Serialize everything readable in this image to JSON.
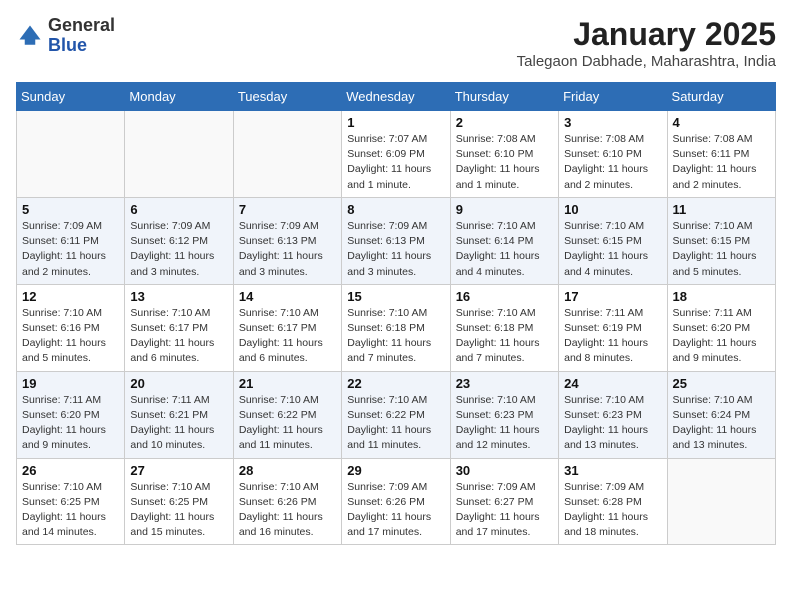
{
  "header": {
    "logo_general": "General",
    "logo_blue": "Blue",
    "month_year": "January 2025",
    "location": "Talegaon Dabhade, Maharashtra, India"
  },
  "days_of_week": [
    "Sunday",
    "Monday",
    "Tuesday",
    "Wednesday",
    "Thursday",
    "Friday",
    "Saturday"
  ],
  "weeks": [
    [
      {
        "day": "",
        "info": ""
      },
      {
        "day": "",
        "info": ""
      },
      {
        "day": "",
        "info": ""
      },
      {
        "day": "1",
        "info": "Sunrise: 7:07 AM\nSunset: 6:09 PM\nDaylight: 11 hours\nand 1 minute."
      },
      {
        "day": "2",
        "info": "Sunrise: 7:08 AM\nSunset: 6:10 PM\nDaylight: 11 hours\nand 1 minute."
      },
      {
        "day": "3",
        "info": "Sunrise: 7:08 AM\nSunset: 6:10 PM\nDaylight: 11 hours\nand 2 minutes."
      },
      {
        "day": "4",
        "info": "Sunrise: 7:08 AM\nSunset: 6:11 PM\nDaylight: 11 hours\nand 2 minutes."
      }
    ],
    [
      {
        "day": "5",
        "info": "Sunrise: 7:09 AM\nSunset: 6:11 PM\nDaylight: 11 hours\nand 2 minutes."
      },
      {
        "day": "6",
        "info": "Sunrise: 7:09 AM\nSunset: 6:12 PM\nDaylight: 11 hours\nand 3 minutes."
      },
      {
        "day": "7",
        "info": "Sunrise: 7:09 AM\nSunset: 6:13 PM\nDaylight: 11 hours\nand 3 minutes."
      },
      {
        "day": "8",
        "info": "Sunrise: 7:09 AM\nSunset: 6:13 PM\nDaylight: 11 hours\nand 3 minutes."
      },
      {
        "day": "9",
        "info": "Sunrise: 7:10 AM\nSunset: 6:14 PM\nDaylight: 11 hours\nand 4 minutes."
      },
      {
        "day": "10",
        "info": "Sunrise: 7:10 AM\nSunset: 6:15 PM\nDaylight: 11 hours\nand 4 minutes."
      },
      {
        "day": "11",
        "info": "Sunrise: 7:10 AM\nSunset: 6:15 PM\nDaylight: 11 hours\nand 5 minutes."
      }
    ],
    [
      {
        "day": "12",
        "info": "Sunrise: 7:10 AM\nSunset: 6:16 PM\nDaylight: 11 hours\nand 5 minutes."
      },
      {
        "day": "13",
        "info": "Sunrise: 7:10 AM\nSunset: 6:17 PM\nDaylight: 11 hours\nand 6 minutes."
      },
      {
        "day": "14",
        "info": "Sunrise: 7:10 AM\nSunset: 6:17 PM\nDaylight: 11 hours\nand 6 minutes."
      },
      {
        "day": "15",
        "info": "Sunrise: 7:10 AM\nSunset: 6:18 PM\nDaylight: 11 hours\nand 7 minutes."
      },
      {
        "day": "16",
        "info": "Sunrise: 7:10 AM\nSunset: 6:18 PM\nDaylight: 11 hours\nand 7 minutes."
      },
      {
        "day": "17",
        "info": "Sunrise: 7:11 AM\nSunset: 6:19 PM\nDaylight: 11 hours\nand 8 minutes."
      },
      {
        "day": "18",
        "info": "Sunrise: 7:11 AM\nSunset: 6:20 PM\nDaylight: 11 hours\nand 9 minutes."
      }
    ],
    [
      {
        "day": "19",
        "info": "Sunrise: 7:11 AM\nSunset: 6:20 PM\nDaylight: 11 hours\nand 9 minutes."
      },
      {
        "day": "20",
        "info": "Sunrise: 7:11 AM\nSunset: 6:21 PM\nDaylight: 11 hours\nand 10 minutes."
      },
      {
        "day": "21",
        "info": "Sunrise: 7:10 AM\nSunset: 6:22 PM\nDaylight: 11 hours\nand 11 minutes."
      },
      {
        "day": "22",
        "info": "Sunrise: 7:10 AM\nSunset: 6:22 PM\nDaylight: 11 hours\nand 11 minutes."
      },
      {
        "day": "23",
        "info": "Sunrise: 7:10 AM\nSunset: 6:23 PM\nDaylight: 11 hours\nand 12 minutes."
      },
      {
        "day": "24",
        "info": "Sunrise: 7:10 AM\nSunset: 6:23 PM\nDaylight: 11 hours\nand 13 minutes."
      },
      {
        "day": "25",
        "info": "Sunrise: 7:10 AM\nSunset: 6:24 PM\nDaylight: 11 hours\nand 13 minutes."
      }
    ],
    [
      {
        "day": "26",
        "info": "Sunrise: 7:10 AM\nSunset: 6:25 PM\nDaylight: 11 hours\nand 14 minutes."
      },
      {
        "day": "27",
        "info": "Sunrise: 7:10 AM\nSunset: 6:25 PM\nDaylight: 11 hours\nand 15 minutes."
      },
      {
        "day": "28",
        "info": "Sunrise: 7:10 AM\nSunset: 6:26 PM\nDaylight: 11 hours\nand 16 minutes."
      },
      {
        "day": "29",
        "info": "Sunrise: 7:09 AM\nSunset: 6:26 PM\nDaylight: 11 hours\nand 17 minutes."
      },
      {
        "day": "30",
        "info": "Sunrise: 7:09 AM\nSunset: 6:27 PM\nDaylight: 11 hours\nand 17 minutes."
      },
      {
        "day": "31",
        "info": "Sunrise: 7:09 AM\nSunset: 6:28 PM\nDaylight: 11 hours\nand 18 minutes."
      },
      {
        "day": "",
        "info": ""
      }
    ]
  ]
}
